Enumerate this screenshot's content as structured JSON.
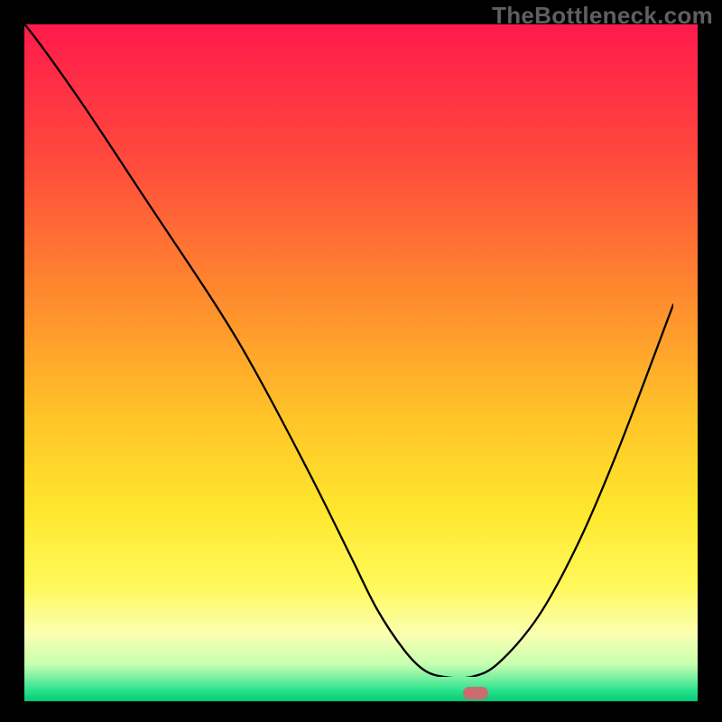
{
  "watermark": "TheBottleneck.com",
  "chart_data": {
    "type": "line",
    "title": "",
    "xlabel": "",
    "ylabel": "",
    "xlim": [
      0,
      100
    ],
    "ylim": [
      0,
      100
    ],
    "grid": false,
    "legend": false,
    "background": "rainbow-vertical-gradient",
    "series": [
      {
        "name": "bottleneck-curve",
        "x": [
          0,
          4,
          12,
          22,
          32,
          38,
          46,
          52,
          56,
          60,
          63,
          66,
          70,
          74,
          80,
          86,
          92,
          100
        ],
        "y": [
          100,
          96,
          85,
          70,
          55,
          45,
          30,
          18,
          10,
          4,
          1,
          0,
          0,
          2,
          9,
          20,
          34,
          55
        ]
      }
    ],
    "annotations": [
      {
        "name": "optimal-marker",
        "x": 67,
        "y": 1.2,
        "shape": "pill",
        "color": "#cb6c70"
      }
    ],
    "gradient_stops": [
      {
        "pos": 0.0,
        "color": "#ff1a4c"
      },
      {
        "pos": 0.2,
        "color": "#ff4a3c"
      },
      {
        "pos": 0.4,
        "color": "#ff8a2e"
      },
      {
        "pos": 0.58,
        "color": "#ffc428"
      },
      {
        "pos": 0.72,
        "color": "#ffe72e"
      },
      {
        "pos": 0.83,
        "color": "#fff95a"
      },
      {
        "pos": 0.9,
        "color": "#fbffb0"
      },
      {
        "pos": 0.945,
        "color": "#c8ffb0"
      },
      {
        "pos": 0.965,
        "color": "#7df0a2"
      },
      {
        "pos": 0.985,
        "color": "#25e28a"
      },
      {
        "pos": 1.0,
        "color": "#06c876"
      }
    ]
  }
}
